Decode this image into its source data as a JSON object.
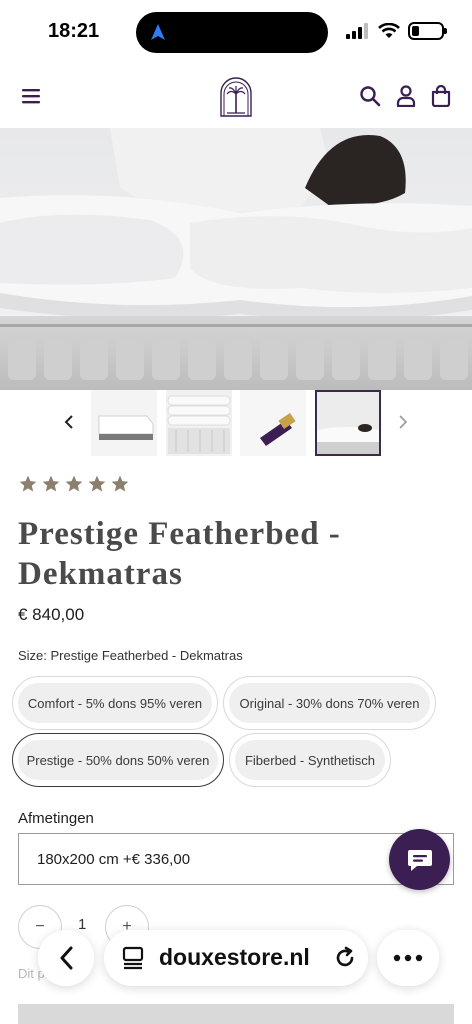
{
  "status_bar": {
    "time": "18:21"
  },
  "colors": {
    "brand": "#3b1f52",
    "star": "#8b7f6d",
    "accent_border": "#3a2b4a"
  },
  "header": {
    "icons": [
      "menu-icon",
      "search-icon",
      "account-icon",
      "bag-icon"
    ]
  },
  "product": {
    "rating_stars": 5,
    "title": "Prestige Featherbed - Dekmatras",
    "price": "€ 840,00",
    "size_label": "Size: Prestige Featherbed - Dekmatras",
    "variants": [
      "Comfort - 5% dons 95% veren",
      "Original - 30% dons 70% veren",
      "Prestige - 50% dons 50% veren",
      "Fiberbed - Synthetisch"
    ],
    "selected_variant": "Prestige - 50% dons 50% veren",
    "dimensions_label": "Afmetingen",
    "dimensions_value": "180x200 cm +€ 336,00",
    "quantity": "1",
    "quantity_minus": "−",
    "quantity_plus": "+",
    "hint_text": "Dit p          t is"
  },
  "safari": {
    "domain": "douxestore.nl"
  }
}
